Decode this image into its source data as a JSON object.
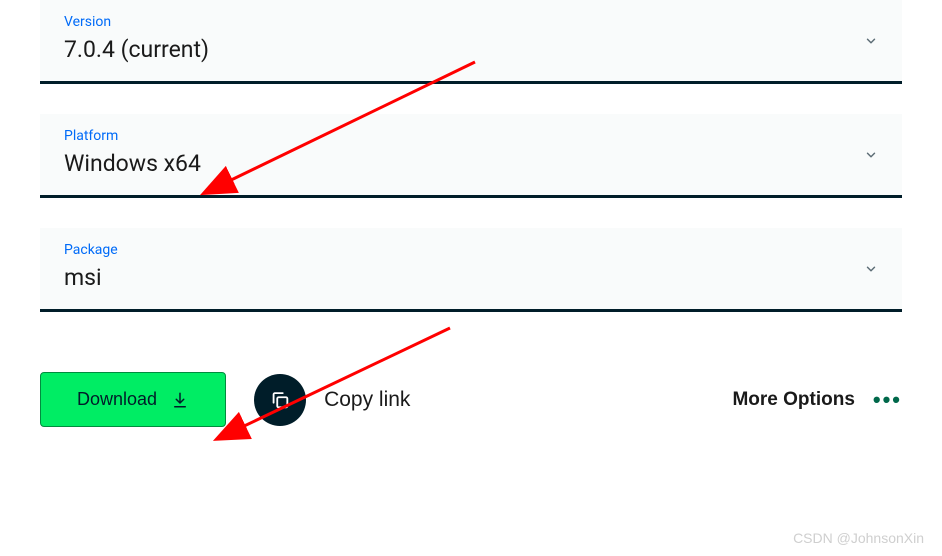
{
  "fields": {
    "version": {
      "label": "Version",
      "value": "7.0.4 (current)"
    },
    "platform": {
      "label": "Platform",
      "value": "Windows x64"
    },
    "package": {
      "label": "Package",
      "value": "msi"
    }
  },
  "actions": {
    "download": "Download",
    "copy_link": "Copy link",
    "more_options": "More Options"
  },
  "colors": {
    "accent_blue": "#016bf8",
    "button_green": "#00ed64",
    "button_green_border": "#008c3e",
    "dark_navy": "#001d29",
    "more_green": "#00684a",
    "arrow_red": "#ff0000"
  },
  "watermark": "CSDN @JohnsonXin"
}
